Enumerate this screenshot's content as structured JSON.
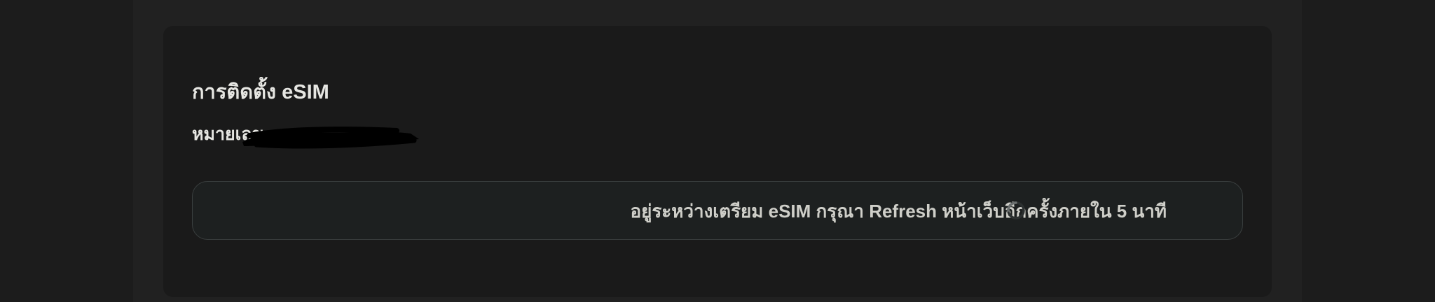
{
  "esim_card": {
    "title": "การติดตั้ง eSIM",
    "number_label": "หมายเลข",
    "number_value_redacted": true,
    "status_message": "อยู่ระหว่างเตรียม eSIM กรุณา Refresh หน้าเว็บอีกครั้งภายใน 5 นาที",
    "status_icon": "loading-spinner-icon"
  },
  "colors": {
    "page_background": "#1c1c1c",
    "outer_panel": "#212121",
    "card_background": "#1a1a1a",
    "status_box_background": "#1d2020",
    "status_box_border": "#3a3f3f",
    "title_text": "#e6e6e2",
    "status_text": "#cfcfc9"
  }
}
